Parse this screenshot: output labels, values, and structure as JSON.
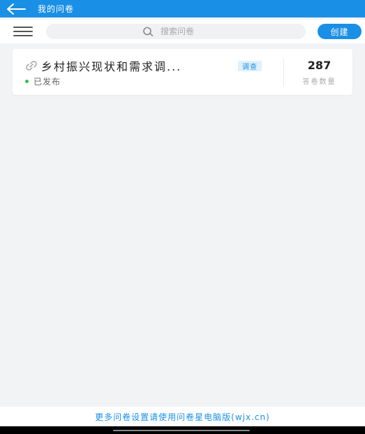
{
  "colors": {
    "accent": "#1a8fe6",
    "status_green": "#2ec24a",
    "background": "#f2f3f5"
  },
  "header": {
    "back_icon": "arrow-left-icon",
    "title": "我的问卷"
  },
  "toolbar": {
    "menu_icon": "hamburger-menu-icon",
    "search_icon": "search-icon",
    "search_placeholder": "搜索问卷",
    "create_label": "创建"
  },
  "surveys": [
    {
      "link_icon": "link-icon",
      "title": "乡村振兴现状和需求调...",
      "tag": "调查",
      "status": "已发布",
      "count": "287",
      "count_label": "答卷数量"
    }
  ],
  "footer": {
    "text": "更多问卷设置请使用问卷星电脑版(wjx.cn)"
  }
}
